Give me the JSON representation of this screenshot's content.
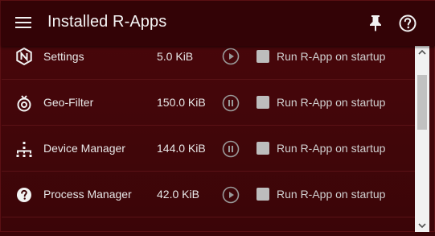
{
  "app_bar": {
    "title": "Installed R-Apps",
    "menu_icon": "menu-icon",
    "pin_icon": "pin-icon",
    "help_icon": "help-circle-icon"
  },
  "apps": [
    {
      "name": "Settings",
      "size": "5.0 KiB",
      "icon": "nexus-logo-icon",
      "state": "stopped",
      "startup_label": "Run R-App on startup",
      "startup_checked": false
    },
    {
      "name": "Geo-Filter",
      "size": "150.0 KiB",
      "icon": "geo-filter-icon",
      "state": "running",
      "startup_label": "Run R-App on startup",
      "startup_checked": false
    },
    {
      "name": "Device Manager",
      "size": "144.0 KiB",
      "icon": "device-tree-icon",
      "state": "running",
      "startup_label": "Run R-App on startup",
      "startup_checked": false
    },
    {
      "name": "Process Manager",
      "size": "42.0 KiB",
      "icon": "question-icon",
      "state": "stopped",
      "startup_label": "Run R-App on startup",
      "startup_checked": false
    }
  ],
  "colors": {
    "app_bar": "#330306",
    "background": "#3b0508",
    "row_divider": "#5a1216",
    "checkbox": "#bdbdbd",
    "scrollbar_track": "#f1f1f1",
    "scrollbar_thumb": "#c1c1c1"
  }
}
